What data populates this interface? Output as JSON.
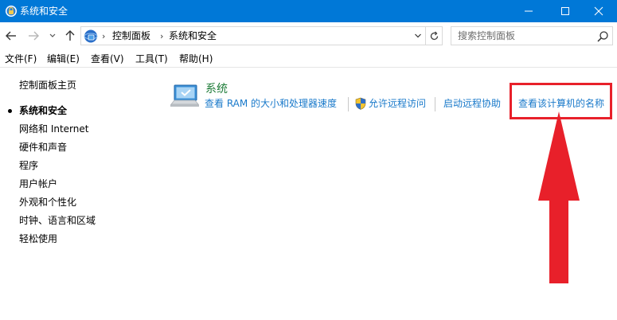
{
  "window": {
    "title": "系统和安全"
  },
  "address": {
    "crumbs": [
      "控制面板",
      "系统和安全"
    ],
    "search_placeholder": "搜索控制面板"
  },
  "menu": {
    "items": [
      "文件(F)",
      "编辑(E)",
      "查看(V)",
      "工具(T)",
      "帮助(H)"
    ]
  },
  "left_nav": {
    "home": "控制面板主页",
    "items": [
      "系统和安全",
      "网络和 Internet",
      "硬件和声音",
      "程序",
      "用户帐户",
      "外观和个性化",
      "时钟、语言和区域",
      "轻松使用"
    ],
    "current_index": 0
  },
  "system_section": {
    "title": "系统",
    "links": [
      "查看 RAM 的大小和处理器速度",
      "允许远程访问",
      "启动远程协助",
      "查看该计算机的名称"
    ]
  },
  "colors": {
    "titlebar": "#0078d7",
    "link": "#1979ca",
    "section_title": "#1e7c38",
    "annotation": "#e8202a"
  }
}
